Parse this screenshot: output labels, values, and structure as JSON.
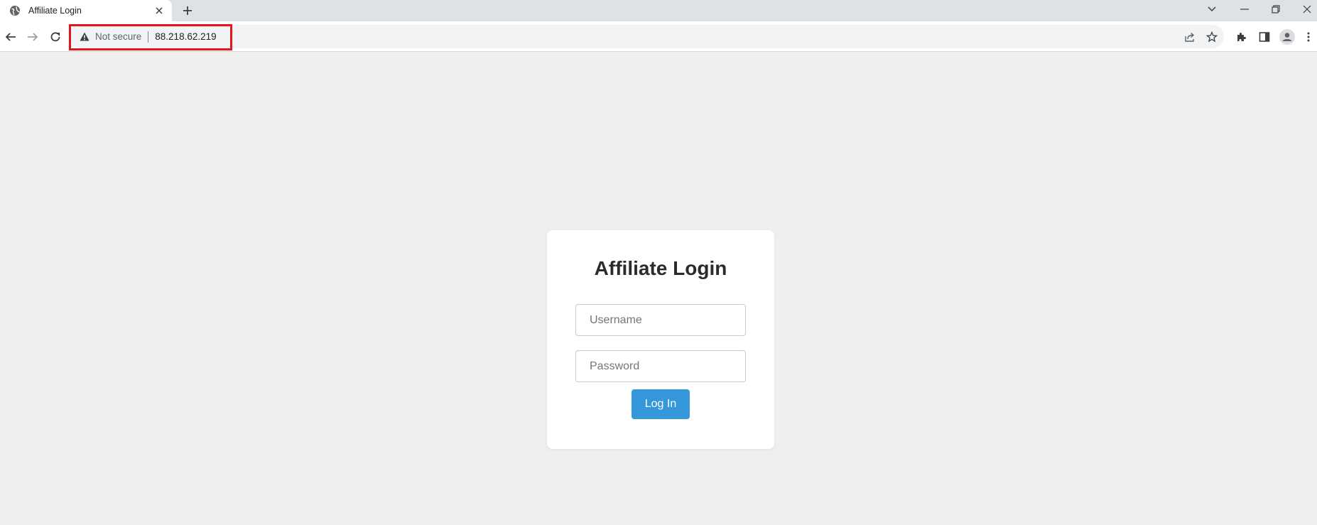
{
  "browser": {
    "tab": {
      "title": "Affiliate Login",
      "favicon": "globe-icon",
      "close_icon": "close-icon"
    },
    "new_tab_icon": "plus-icon",
    "window_controls": [
      "chevron-down-icon",
      "minimize-icon",
      "restore-icon",
      "close-icon"
    ],
    "address_bar": {
      "security_icon": "warning-triangle-icon",
      "security_text": "Not secure",
      "url": "88.218.62.219",
      "highlight_color": "#e8141b"
    },
    "toolbar_icons": [
      "back-arrow-icon",
      "forward-arrow-icon",
      "reload-icon",
      "share-icon",
      "star-icon",
      "extensions-puzzle-icon",
      "side-panel-icon",
      "profile-avatar-icon",
      "more-vert-icon"
    ]
  },
  "page": {
    "background_color": "#efefef",
    "login_card": {
      "title": "Affiliate Login",
      "username_placeholder": "Username",
      "password_placeholder": "Password",
      "submit_label": "Log In",
      "button_color": "#3498db"
    }
  }
}
